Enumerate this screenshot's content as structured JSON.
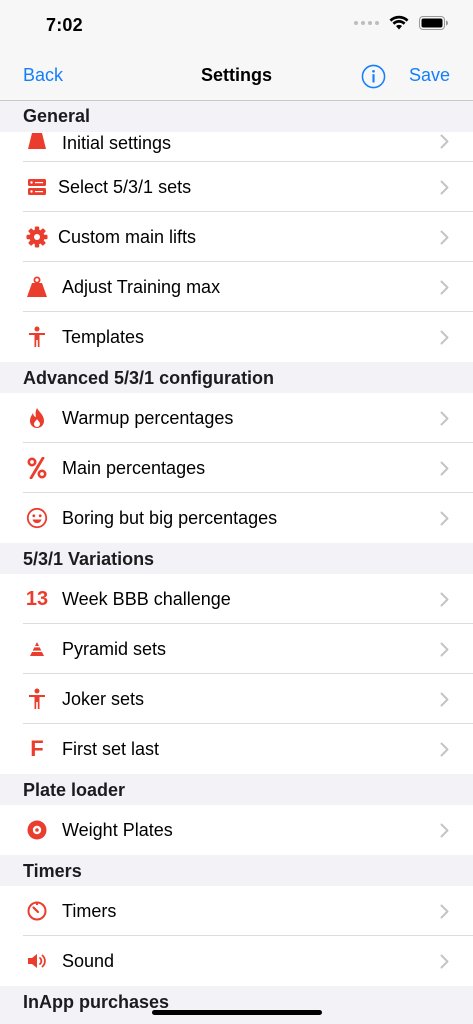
{
  "status": {
    "time": "7:02"
  },
  "nav": {
    "back": "Back",
    "title": "Settings",
    "save": "Save"
  },
  "colors": {
    "accent": "#147efb",
    "icon": "#eb3d2e",
    "chevron": "#c4c4c7"
  },
  "sections": {
    "general": "General",
    "advanced": "Advanced 5/3/1 configuration",
    "variations": "5/3/1 Variations",
    "plate": "Plate loader",
    "timers": "Timers",
    "inapp": "InApp purchases"
  },
  "items": {
    "initial_settings": "Initial settings",
    "select_sets": "Select 5/3/1 sets",
    "custom_lifts": "Custom main lifts",
    "adjust_tm": "Adjust Training max",
    "templates": "Templates",
    "warmup": "Warmup percentages",
    "main_pct": "Main percentages",
    "bbb_pct": "Boring but big percentages",
    "week_bbb": "Week BBB challenge",
    "pyramid": "Pyramid sets",
    "joker": "Joker sets",
    "fsl": "First set last",
    "plates": "Weight Plates",
    "timers": "Timers",
    "sound": "Sound"
  },
  "icons": {
    "week_number": "13",
    "fsl_letter": "F"
  }
}
